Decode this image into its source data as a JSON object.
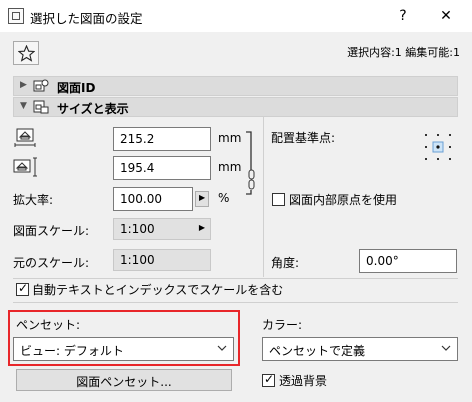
{
  "window": {
    "title": "選択した図面の設定",
    "help_label": "?",
    "close_label": "✕"
  },
  "header": {
    "favorite_icon": "star-icon",
    "selection_info": "選択内容:1 編集可能:1"
  },
  "panels": [
    {
      "label": "図面ID",
      "icon": "drawing-id-icon"
    },
    {
      "label": "サイズと表示",
      "icon": "drawing-size-icon"
    }
  ],
  "size": {
    "width_value": "215.2",
    "width_unit": "mm",
    "height_value": "195.4",
    "height_unit": "mm",
    "zoom_label": "拡大率:",
    "zoom_value": "100.00",
    "zoom_unit": "%",
    "scale_label": "図面スケール:",
    "scale_value": "1:100",
    "orig_scale_label": "元のスケール:",
    "orig_scale_value": "1:100"
  },
  "anchor": {
    "label": "配置基準点:",
    "use_origin_label": "図面内部原点を使用",
    "use_origin_checked": false
  },
  "angle": {
    "label": "角度:",
    "value": "0.00°"
  },
  "auto_text": {
    "label": "自動テキストとインデックスでスケールを含む",
    "checked": true
  },
  "pen": {
    "label": "ペンセット:",
    "value": "ビュー: デフォルト",
    "button_label": "図面ペンセット..."
  },
  "color": {
    "label": "カラー:",
    "value": "ペンセットで定義"
  },
  "transparent": {
    "label": "透過背景",
    "checked": true
  },
  "colors": {
    "highlight": "#e8262a"
  }
}
